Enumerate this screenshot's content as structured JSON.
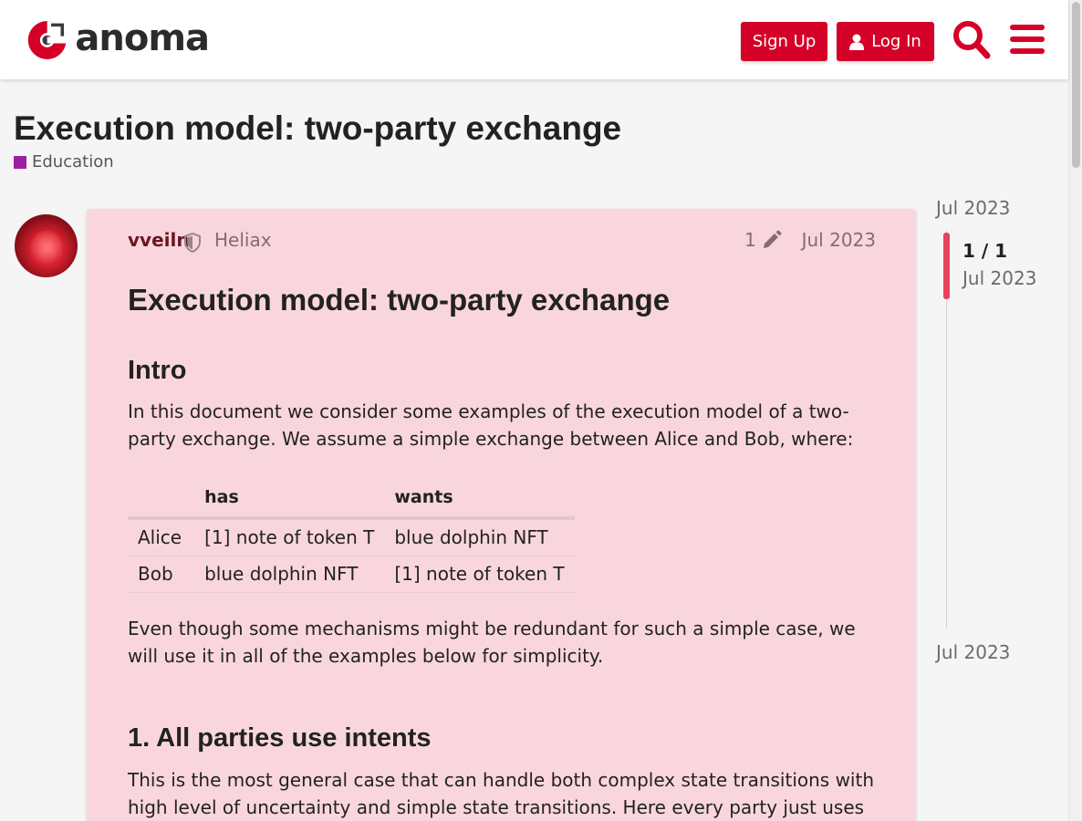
{
  "header": {
    "logo_text": "anoma",
    "signup_label": "Sign Up",
    "login_label": "Log In",
    "brand_color": "#d50027"
  },
  "topic": {
    "title": "Execution model: two-party exchange",
    "category": "Education",
    "category_color": "#9c1fa0"
  },
  "post": {
    "username": "vveiln",
    "group": "Heliax",
    "edit_count": "1",
    "date": "Jul 2023",
    "heading": "Execution model: two-party exchange",
    "intro_heading": "Intro",
    "intro_text": "In this document we consider some examples of the execution model of a two-party exchange. We assume a simple exchange between Alice and Bob, where:",
    "table": {
      "headers": [
        "",
        "has",
        "wants"
      ],
      "rows": [
        [
          "Alice",
          "[1] note of token T",
          "blue dolphin NFT"
        ],
        [
          "Bob",
          "blue dolphin NFT",
          "[1] note of token T"
        ]
      ]
    },
    "after_table_text": "Even though some mechanisms might be redundant for such a simple case, we will use it in all of the examples below for simplicity.",
    "section1_heading": "1. All parties use intents",
    "section1_text": "This is the most general case that can handle both complex state transitions with high level of uncertainty and simple state transitions. Here every party just uses intents to express their interests."
  },
  "timeline": {
    "start_date": "Jul 2023",
    "position": "1 / 1",
    "position_date": "Jul 2023",
    "end_date": "Jul 2023"
  },
  "icons": {
    "search": "search-icon",
    "menu": "hamburger-menu-icon",
    "user": "user-icon",
    "shield": "shield-icon",
    "pencil": "pencil-icon"
  }
}
